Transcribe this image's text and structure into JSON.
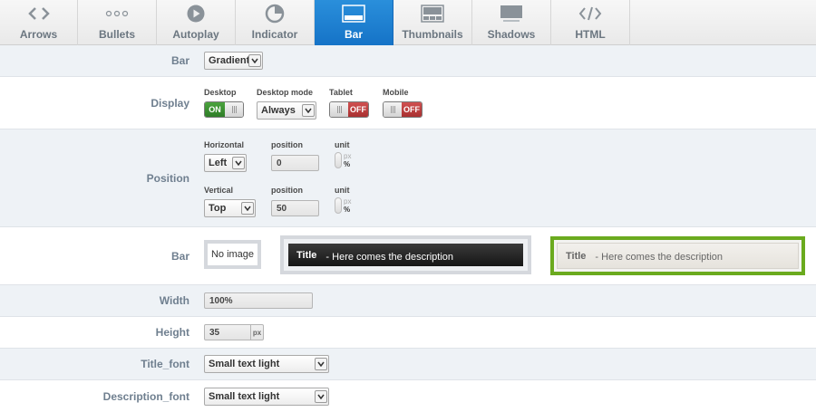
{
  "tabs": [
    {
      "label": "Arrows",
      "icon": "arrows-icon"
    },
    {
      "label": "Bullets",
      "icon": "bullets-icon"
    },
    {
      "label": "Autoplay",
      "icon": "autoplay-icon"
    },
    {
      "label": "Indicator",
      "icon": "indicator-icon"
    },
    {
      "label": "Bar",
      "icon": "bar-icon",
      "active": true
    },
    {
      "label": "Thumbnails",
      "icon": "thumbnails-icon"
    },
    {
      "label": "Shadows",
      "icon": "shadows-icon"
    },
    {
      "label": "HTML",
      "icon": "html-icon"
    }
  ],
  "bar_type": {
    "label": "Bar",
    "value": "Gradient"
  },
  "display": {
    "label": "Display",
    "desktop": {
      "label": "Desktop",
      "state": "ON"
    },
    "desktop_mode": {
      "label": "Desktop mode",
      "value": "Always"
    },
    "tablet": {
      "label": "Tablet",
      "state": "OFF"
    },
    "mobile": {
      "label": "Mobile",
      "state": "OFF"
    }
  },
  "position": {
    "label": "Position",
    "horizontal": {
      "label": "Horizontal",
      "value": "Left",
      "position_label": "position",
      "position_value": "0",
      "unit_label": "unit",
      "unit_px": "px",
      "unit_pct": "%"
    },
    "vertical": {
      "label": "Vertical",
      "value": "Top",
      "position_label": "position",
      "position_value": "50",
      "unit_label": "unit",
      "unit_px": "px",
      "unit_pct": "%"
    }
  },
  "bar_style": {
    "label": "Bar",
    "no_image": "No image",
    "dark_preview": {
      "title": "Title",
      "description": "- Here comes the description"
    },
    "light_preview": {
      "title": "Title",
      "description": "- Here comes the description"
    }
  },
  "width": {
    "label": "Width",
    "value": "100%"
  },
  "height": {
    "label": "Height",
    "value": "35",
    "unit": "px"
  },
  "title_font": {
    "label": "Title_font",
    "value": "Small text light"
  },
  "description_font": {
    "label": "Description_font",
    "value": "Small text light"
  },
  "colors": {
    "active_tab": "#1a7fd4",
    "selected_border": "#6aaa1e",
    "on": "#3d8f32",
    "off": "#b83a3a"
  }
}
